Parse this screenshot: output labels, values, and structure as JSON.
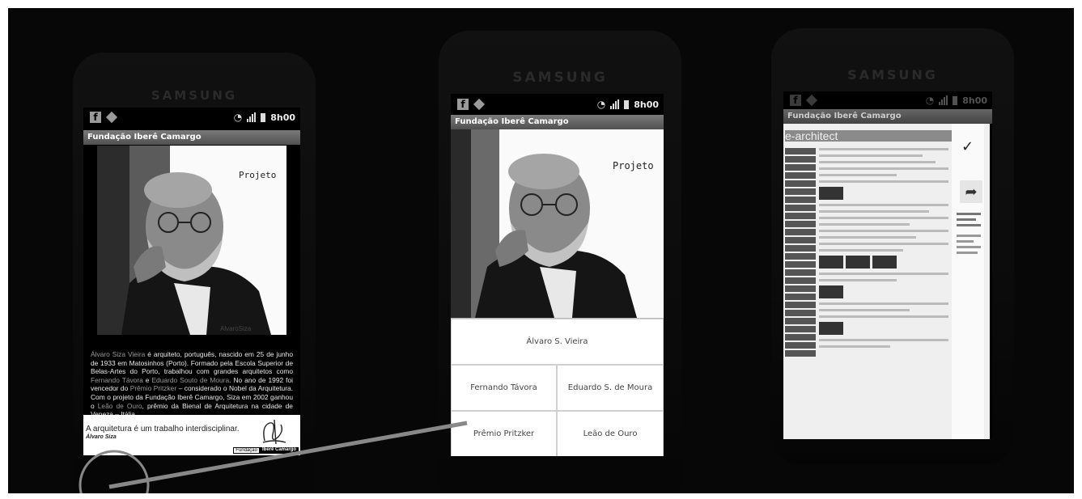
{
  "phones": {
    "left": {
      "brand": "SAMSUNG",
      "status": {
        "clock": "8h00"
      },
      "app_title": "Fundação Iberê Camargo",
      "projeto_label": "Projeto",
      "photo_caption": "AlvaroSiza",
      "bio": {
        "p1": "Álvaro Siza Vieira",
        "p2": " é arquiteto, português, nascido em 25 de junho de 1933 em Matosinhos (Porto). Formado pela Escola Superior de Belas-Artes do Porto, trabalhou com grandes arquitetos como ",
        "p3": "Fernando Távora",
        "p4": " e ",
        "p5": "Eduardo Souto de Moura",
        "p6": ". No ano de 1992 foi vencedor do ",
        "p7": "Prêmio Pritzker",
        "p8": " – considerado o Nobel da Arquitetura. Com o projeto da Fundação Iberê Camargo, Siza em 2002 ganhou o ",
        "p9": "Leão de Ouro",
        "p10": ", prêmio da Bienal de Arquitetura na cidade de Veneza – Itália."
      },
      "quote": {
        "text": "A arquitetura é um trabalho interdisciplinar.",
        "author": "Álvaro Siza",
        "logo_a": "Fundação",
        "logo_b": "Iberê Camargo"
      }
    },
    "middle": {
      "brand": "SAMSUNG",
      "status": {
        "clock": "8h00"
      },
      "app_title": "Fundação Iberê Camargo",
      "projeto_label": "Projeto",
      "menu": {
        "top": "Álvaro S. Vieira",
        "r1c1": "Fernando Távora",
        "r1c2": "Eduardo S. de Moura",
        "r2c1": "Prêmio Pritzker",
        "r2c2": "Leão de Ouro"
      }
    },
    "right": {
      "brand": "SAMSUNG",
      "status": {
        "clock": "8h00"
      },
      "app_title": "Fundação Iberê Camargo",
      "site_logo": "e-architect"
    }
  },
  "colors": {
    "background": "#070707",
    "title_bar": "#5a5a5a",
    "highlight_link": "#9a9a9a",
    "annotation_line": "#888888"
  }
}
